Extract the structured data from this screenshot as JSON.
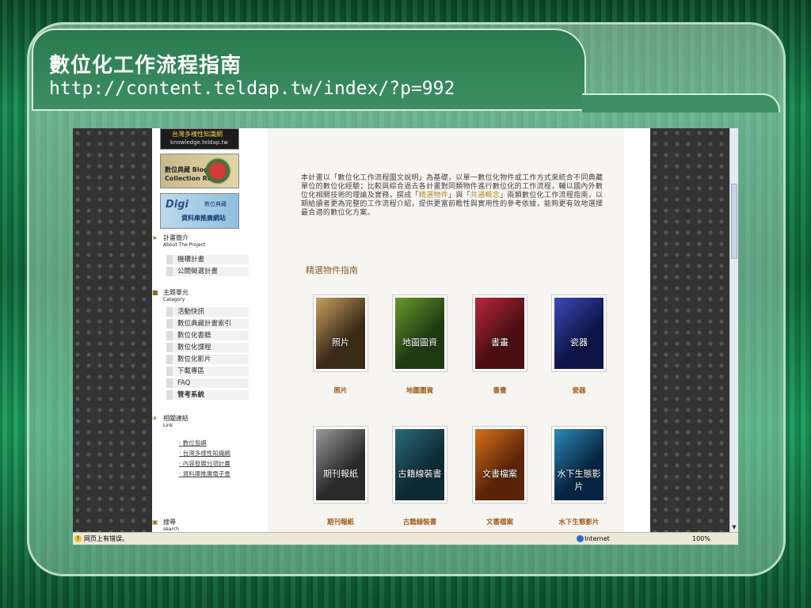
{
  "slide": {
    "title": "數位化工作流程指南",
    "url": "http://content.teldap.tw/index/?p=992"
  },
  "sidebar": {
    "banner1_line1": "台灣多樣性知識網",
    "banner1_line2": "knowledge.teldap.tw",
    "banner2_line1": "數位典藏 Blog",
    "banner2_line2": "Collection Room",
    "banner3_logo": "Digi",
    "banner3_line1": "數位典藏",
    "banner3_line2": "資料庫推廣網站",
    "section_about": {
      "zh": "計畫簡介",
      "en": "About The Project"
    },
    "about_items": [
      "機構計畫",
      "公開徵選計畫"
    ],
    "section_category": {
      "zh": "主題單元",
      "en": "Category"
    },
    "category_items": [
      "活動快訊",
      "數位典藏計畫索引",
      "數位化書籍",
      "數位化課程",
      "數位化影片",
      "下載專區",
      "FAQ",
      "管考系統"
    ],
    "section_link": {
      "zh": "相關連結",
      "en": "Link"
    },
    "link_items": [
      "數位島嶼",
      "台灣多樣性知識網",
      "內容發展分項計畫",
      "資料庫推廣電子書"
    ],
    "section_search": {
      "zh": "搜尋",
      "en": "search"
    }
  },
  "main": {
    "intro_part1": "本計畫以「數位化工作流程圖文說明」為基礎，以單一數位化物件或工作方式來統合不同典藏單位的數位化經驗；比較與綜合過去各計畫對同類物件進行數位化的工作流程，輔以國內外數位化相關技術的理論及實務，撰成「",
    "intro_hl1": "精選物件",
    "intro_part2": "」與「",
    "intro_hl2": "共通概念",
    "intro_part3": "」兩類數位化工作流程指南，以期給讀者更為完整的工作流程介紹，提供更富前瞻性與實用性的參考依據，能夠更有效地選擇最合適的數位化方案。",
    "section_title": "精選物件指南",
    "covers": [
      {
        "title": "照片",
        "label": "照片",
        "color1": "#3a2a18",
        "color2": "#c8a060"
      },
      {
        "title": "地圖圖資",
        "label": "地圖圖資",
        "color1": "#1d3a12",
        "color2": "#6a9a2a"
      },
      {
        "title": "書畫",
        "label": "書畫",
        "color1": "#4a0e12",
        "color2": "#b8283a"
      },
      {
        "title": "瓷器",
        "label": "瓷器",
        "color1": "#0e1448",
        "color2": "#3a4ab8"
      },
      {
        "title": "期刊報紙",
        "label": "期刊報紙",
        "color1": "#2a2a2a",
        "color2": "#9a9a9a"
      },
      {
        "title": "古籍線裝書",
        "label": "古籍線裝書",
        "color1": "#0e2a32",
        "color2": "#2a6a7a"
      },
      {
        "title": "文書檔案",
        "label": "文書檔案",
        "color1": "#5a2408",
        "color2": "#d8701a"
      },
      {
        "title": "水下生態影片",
        "label": "水下生態影片",
        "color1": "#072440",
        "color2": "#2a8ab8"
      }
    ]
  },
  "statusbar": {
    "message": "网页上有错误。",
    "zone": "Internet",
    "zoom": "100%"
  }
}
